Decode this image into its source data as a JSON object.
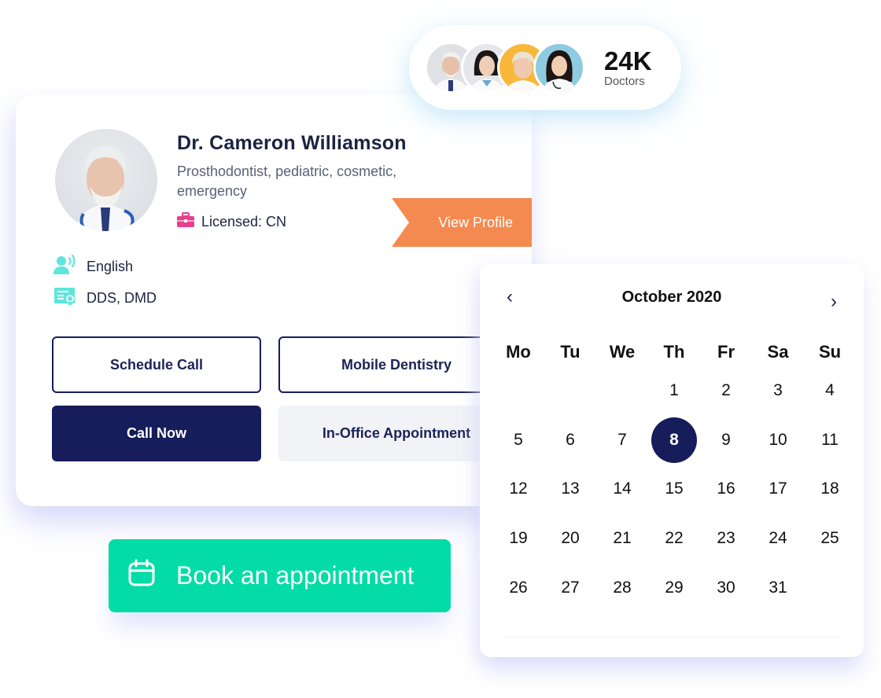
{
  "doctors_badge": {
    "count": "24K",
    "label": "Doctors",
    "avatars": [
      "doctor-avatar-older-man",
      "doctor-avatar-young-woman",
      "doctor-avatar-blonde-woman",
      "doctor-avatar-dark-hair-woman"
    ]
  },
  "profile": {
    "name": "Dr. Cameron Williamson",
    "specialties": "Prosthodontist, pediatric, cosmetic, emergency",
    "license": "Licensed: CN",
    "view_profile": "View Profile",
    "language": "English",
    "degrees": "DDS, DMD"
  },
  "actions": {
    "schedule_call": "Schedule Call",
    "mobile_dentistry": "Mobile Dentistry",
    "call_now": "Call Now",
    "in_office": "In-Office Appointment"
  },
  "book": {
    "label": "Book an appointment"
  },
  "calendar": {
    "title": "October 2020",
    "prev": "‹",
    "next": "›",
    "weekdays": [
      "Mo",
      "Tu",
      "We",
      "Th",
      "Fr",
      "Sa",
      "Su"
    ],
    "selected_day": "8",
    "weeks": [
      [
        "",
        "",
        "",
        "1",
        "2",
        "3",
        "4"
      ],
      [
        "5",
        "6",
        "7",
        "8",
        "9",
        "10",
        "11"
      ],
      [
        "12",
        "13",
        "14",
        "15",
        "16",
        "17",
        "18"
      ],
      [
        "19",
        "20",
        "21",
        "22",
        "23",
        "24",
        "25"
      ],
      [
        "26",
        "27",
        "28",
        "29",
        "30",
        "31",
        ""
      ]
    ]
  },
  "colors": {
    "navy": "#161d5a",
    "orange": "#f48a4f",
    "green": "#04dca7",
    "teal_icon": "#5ee6dc",
    "pink_icon": "#e83e8c"
  }
}
